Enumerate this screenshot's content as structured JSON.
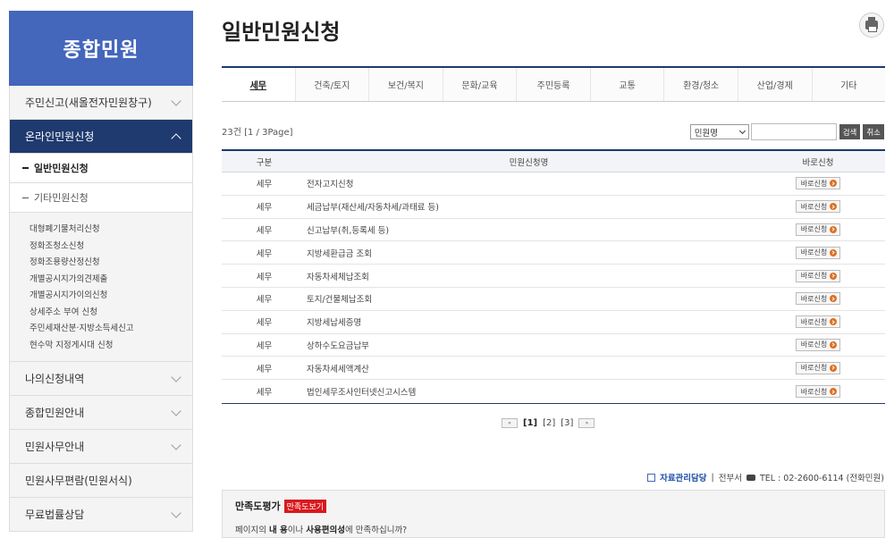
{
  "sidebar": {
    "title": "종합민원",
    "items": [
      {
        "label": "주민신고(새올전자민원창구)"
      },
      {
        "label": "온라인민원신청"
      },
      {
        "label": "나의신청내역"
      },
      {
        "label": "종합민원안내"
      },
      {
        "label": "민원사무안내"
      },
      {
        "label": "민원사무편람(민원서식)"
      },
      {
        "label": "무료법률상담"
      }
    ],
    "subitems": [
      {
        "label": "일반민원신청"
      },
      {
        "label": "기타민원신청"
      }
    ],
    "leaves": [
      "대형폐기물처리신청",
      "정화조청소신청",
      "정화조용량산정신청",
      "개별공시지가의견제출",
      "개별공시지가이의신청",
      "상세주소 부여 신청",
      "주민세재산분·지방소득세신고",
      "현수막 지정게시대 신청"
    ]
  },
  "main": {
    "title": "일반민원신청",
    "tabs": [
      "세무",
      "건축/토지",
      "보건/복지",
      "문화/교육",
      "주민등록",
      "교통",
      "환경/청소",
      "산업/경제",
      "기타"
    ],
    "count": "23건 [1 / 3Page]",
    "search": {
      "select_value": "민원명",
      "search_label": "검색",
      "cancel_label": "취소"
    },
    "table": {
      "headers": [
        "구분",
        "민원신청명",
        "바로신청"
      ],
      "apply_label": "바로신청",
      "rows": [
        {
          "category": "세무",
          "name": "전자고지신청"
        },
        {
          "category": "세무",
          "name": "세금납부(재산세/자동차세/과태료 등)"
        },
        {
          "category": "세무",
          "name": "신고납부(취,등록세 등)"
        },
        {
          "category": "세무",
          "name": "지방세환급금 조회"
        },
        {
          "category": "세무",
          "name": "자동차세체납조회"
        },
        {
          "category": "세무",
          "name": "토지/건물체납조회"
        },
        {
          "category": "세무",
          "name": "지방세납세증명"
        },
        {
          "category": "세무",
          "name": "상하수도요금납부"
        },
        {
          "category": "세무",
          "name": "자동차세세액계산"
        },
        {
          "category": "세무",
          "name": "법인세무조사인터넷신고시스템"
        }
      ]
    },
    "pager": {
      "prev": "«",
      "next": "»",
      "pages": [
        "[1]",
        "[2]",
        "[3]"
      ]
    },
    "contact": {
      "manager_label": "자료관리담당",
      "dept": "전부서",
      "tel": "TEL : 02-2600-6114 (전화민원)"
    },
    "survey": {
      "title": "만족도평가",
      "view_button": "만족도보기",
      "q_prefix": "페이지의 ",
      "q_b1": "내 용",
      "q_mid": "이나 ",
      "q_b2": "사용편의성",
      "q_suffix": "에 만족하십니까?"
    }
  },
  "colors": {
    "brand": "#4466bb",
    "nav_active": "#1e3a6e",
    "survey_red": "#d9191e"
  }
}
